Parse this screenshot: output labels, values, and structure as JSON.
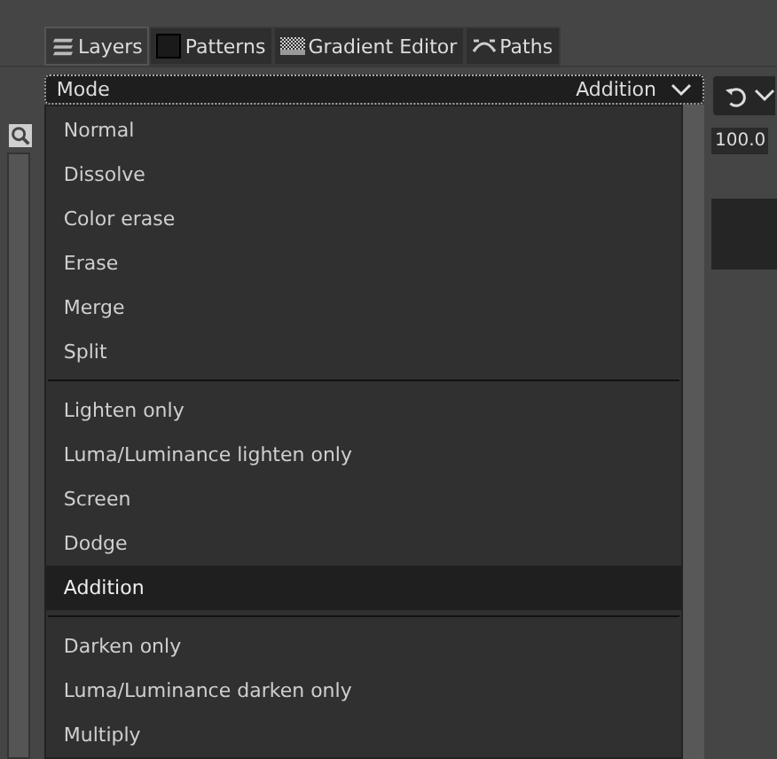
{
  "tabs": [
    {
      "label": "Layers",
      "kind": "layers",
      "selected": true
    },
    {
      "label": "Patterns",
      "kind": "pattern",
      "selected": false
    },
    {
      "label": "Gradient Editor",
      "kind": "gradient",
      "selected": false
    },
    {
      "label": "Paths",
      "kind": "paths",
      "selected": false
    }
  ],
  "mode": {
    "label": "Mode",
    "value": "Addition"
  },
  "opacity": {
    "value": "100.0"
  },
  "menu": [
    {
      "kind": "item",
      "label": "Normal",
      "selected": false
    },
    {
      "kind": "item",
      "label": "Dissolve",
      "selected": false
    },
    {
      "kind": "item",
      "label": "Color erase",
      "selected": false
    },
    {
      "kind": "item",
      "label": "Erase",
      "selected": false
    },
    {
      "kind": "item",
      "label": "Merge",
      "selected": false
    },
    {
      "kind": "item",
      "label": "Split",
      "selected": false
    },
    {
      "kind": "separator"
    },
    {
      "kind": "item",
      "label": "Lighten only",
      "selected": false
    },
    {
      "kind": "item",
      "label": "Luma/Luminance lighten only",
      "selected": false
    },
    {
      "kind": "item",
      "label": "Screen",
      "selected": false
    },
    {
      "kind": "item",
      "label": "Dodge",
      "selected": false
    },
    {
      "kind": "item",
      "label": "Addition",
      "selected": true
    },
    {
      "kind": "separator"
    },
    {
      "kind": "item",
      "label": "Darken only",
      "selected": false
    },
    {
      "kind": "item",
      "label": "Luma/Luminance darken only",
      "selected": false
    },
    {
      "kind": "item",
      "label": "Multiply",
      "selected": false
    }
  ]
}
